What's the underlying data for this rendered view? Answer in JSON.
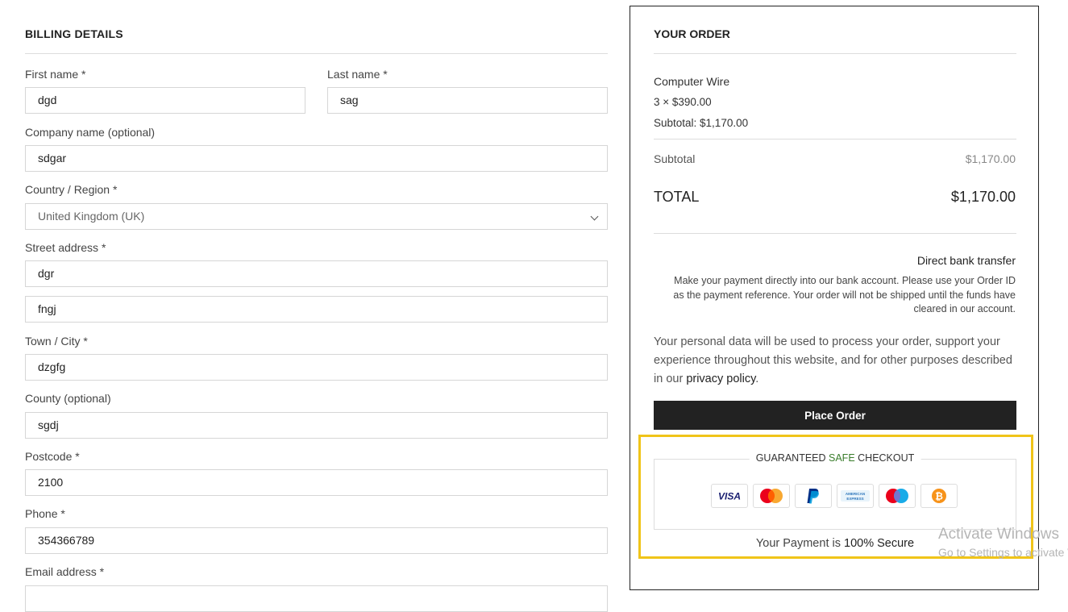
{
  "billing": {
    "title": "BILLING DETAILS",
    "first_name": {
      "label": "First name *",
      "value": "dgd"
    },
    "last_name": {
      "label": "Last name *",
      "value": "sag"
    },
    "company": {
      "label": "Company name (optional)",
      "value": "sdgar"
    },
    "country": {
      "label": "Country / Region *",
      "value": "United Kingdom (UK)"
    },
    "street": {
      "label": "Street address *",
      "value1": "dgr",
      "value2": "fngj"
    },
    "town": {
      "label": "Town / City *",
      "value": "dzgfg"
    },
    "county": {
      "label": "County (optional)",
      "value": "sgdj"
    },
    "postcode": {
      "label": "Postcode *",
      "value": "2100"
    },
    "phone": {
      "label": "Phone *",
      "value": "354366789"
    },
    "email": {
      "label": "Email address *",
      "value": ""
    }
  },
  "order": {
    "title": "YOUR ORDER",
    "item_name": "Computer Wire",
    "item_qty_price": "3 × $390.00",
    "item_subtotal": "Subtotal: $1,170.00",
    "subtotal_label": "Subtotal",
    "subtotal_value": "$1,170.00",
    "total_label": "TOTAL",
    "total_value": "$1,170.00",
    "payment_method": "Direct bank transfer",
    "payment_description": "Make your payment directly into our bank account. Please use your Order ID as the payment reference. Your order will not be shipped until the funds have cleared in our account.",
    "privacy_text": "Your personal data will be used to process your order, support your experience throughout this website, and for other purposes described in our",
    "privacy_link": "privacy policy",
    "privacy_end": ".",
    "place_order": "Place Order"
  },
  "secure": {
    "title_pre": "GUARANTEED ",
    "title_safe": "SAFE",
    "title_post": " CHECKOUT",
    "note_pre": "Your Payment is ",
    "note_bold": "100% Secure",
    "cards": [
      "visa-icon",
      "mastercard-icon",
      "paypal-icon",
      "amex-icon",
      "maestro-icon",
      "bitcoin-icon"
    ],
    "visa_text": "VISA",
    "amex_text": "AMERICAN EXPRESS"
  },
  "watermark": {
    "line1": "Activate Windows",
    "line2": "Go to Settings to activate Windows."
  },
  "colors": {
    "highlight": "#f0c419",
    "safe_green": "#3a7d2c",
    "button_bg": "#222222"
  }
}
